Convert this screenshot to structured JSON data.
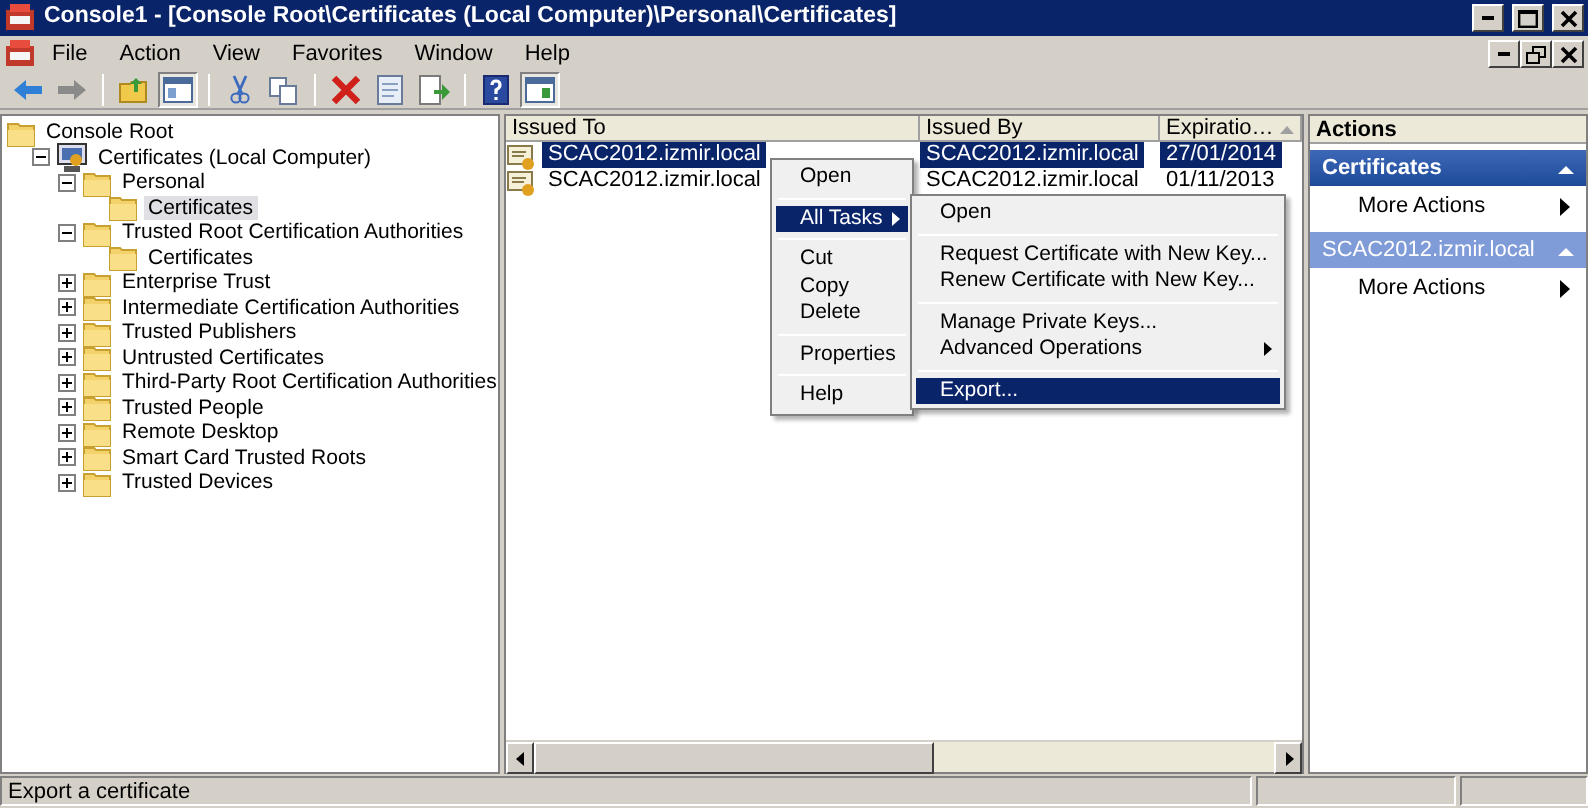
{
  "window": {
    "title": "Console1 - [Console Root\\Certificates (Local Computer)\\Personal\\Certificates]"
  },
  "menu": [
    "File",
    "Action",
    "View",
    "Favorites",
    "Window",
    "Help"
  ],
  "toolbar": [
    [
      {
        "kind": "back",
        "pressed": false
      },
      {
        "kind": "forward",
        "pressed": false
      }
    ],
    [
      {
        "kind": "up",
        "pressed": false
      },
      {
        "kind": "tree",
        "pressed": true
      }
    ],
    [
      {
        "kind": "cut",
        "pressed": false
      },
      {
        "kind": "copy",
        "pressed": false
      }
    ],
    [
      {
        "kind": "delete",
        "pressed": false
      },
      {
        "kind": "properties",
        "pressed": false
      },
      {
        "kind": "export",
        "pressed": false
      }
    ],
    [
      {
        "kind": "help",
        "pressed": false
      },
      {
        "kind": "pane",
        "pressed": true
      }
    ]
  ],
  "tree": [
    {
      "label": "Console Root",
      "kind": "folder",
      "selected": false,
      "children": [
        {
          "label": "Certificates (Local Computer)",
          "kind": "computer",
          "selected": false,
          "expanded": true,
          "children": [
            {
              "label": "Personal",
              "kind": "folder",
              "selected": false,
              "expanded": true,
              "children": [
                {
                  "label": "Certificates",
                  "kind": "folder",
                  "selected": true
                }
              ]
            },
            {
              "label": "Trusted Root Certification Authorities",
              "kind": "folder",
              "selected": false,
              "expanded": true,
              "children": [
                {
                  "label": "Certificates",
                  "kind": "folder",
                  "selected": false
                }
              ]
            },
            {
              "label": "Enterprise Trust",
              "kind": "folder",
              "selected": false,
              "expanded": false
            },
            {
              "label": "Intermediate Certification Authorities",
              "kind": "folder",
              "selected": false,
              "expanded": false
            },
            {
              "label": "Trusted Publishers",
              "kind": "folder",
              "selected": false,
              "expanded": false
            },
            {
              "label": "Untrusted Certificates",
              "kind": "folder",
              "selected": false,
              "expanded": false
            },
            {
              "label": "Third-Party Root Certification Authorities",
              "kind": "folder",
              "selected": false,
              "expanded": false
            },
            {
              "label": "Trusted People",
              "kind": "folder",
              "selected": false,
              "expanded": false
            },
            {
              "label": "Remote Desktop",
              "kind": "folder",
              "selected": false,
              "expanded": false
            },
            {
              "label": "Smart Card Trusted Roots",
              "kind": "folder",
              "selected": false,
              "expanded": false
            },
            {
              "label": "Trusted Devices",
              "kind": "folder",
              "selected": false,
              "expanded": false
            }
          ]
        }
      ]
    }
  ],
  "table": {
    "columns": [
      "Issued To",
      "Issued By",
      "Expiratio…"
    ],
    "rows": [
      {
        "selected": true,
        "cells": [
          "SCAC2012.izmir.local",
          "SCAC2012.izmir.local",
          "27/01/2014"
        ]
      },
      {
        "selected": false,
        "cells": [
          "SCAC2012.izmir.local",
          "SCAC2012.izmir.local",
          "01/11/2013"
        ]
      }
    ]
  },
  "context_menu": {
    "groups": [
      [
        {
          "label": "Open",
          "selected": false,
          "has_submenu": false
        }
      ],
      [
        {
          "label": "All Tasks",
          "selected": true,
          "has_submenu": true
        }
      ],
      [
        {
          "label": "Cut",
          "selected": false,
          "has_submenu": false
        },
        {
          "label": "Copy",
          "selected": false,
          "has_submenu": false
        },
        {
          "label": "Delete",
          "selected": false,
          "has_submenu": false
        }
      ],
      [
        {
          "label": "Properties",
          "selected": false,
          "has_submenu": false
        }
      ],
      [
        {
          "label": "Help",
          "selected": false,
          "has_submenu": false
        }
      ]
    ]
  },
  "submenu": {
    "groups": [
      [
        {
          "label": "Open",
          "selected": false,
          "has_submenu": false
        }
      ],
      [
        {
          "label": "Request Certificate with New Key...",
          "selected": false,
          "has_submenu": false
        },
        {
          "label": "Renew Certificate with New Key...",
          "selected": false,
          "has_submenu": false
        }
      ],
      [
        {
          "label": "Manage Private Keys...",
          "selected": false,
          "has_submenu": false
        },
        {
          "label": "Advanced Operations",
          "selected": false,
          "has_submenu": true
        }
      ],
      [
        {
          "label": "Export...",
          "selected": true,
          "has_submenu": false
        }
      ]
    ]
  },
  "actions": {
    "title": "Actions",
    "sections": [
      {
        "title": "Certificates",
        "selected": false,
        "items": [
          "More Actions"
        ]
      },
      {
        "title": "SCAC2012.izmir.local",
        "selected": true,
        "items": [
          "More Actions"
        ]
      }
    ]
  },
  "status_bar": {
    "text": "Export a certificate"
  }
}
